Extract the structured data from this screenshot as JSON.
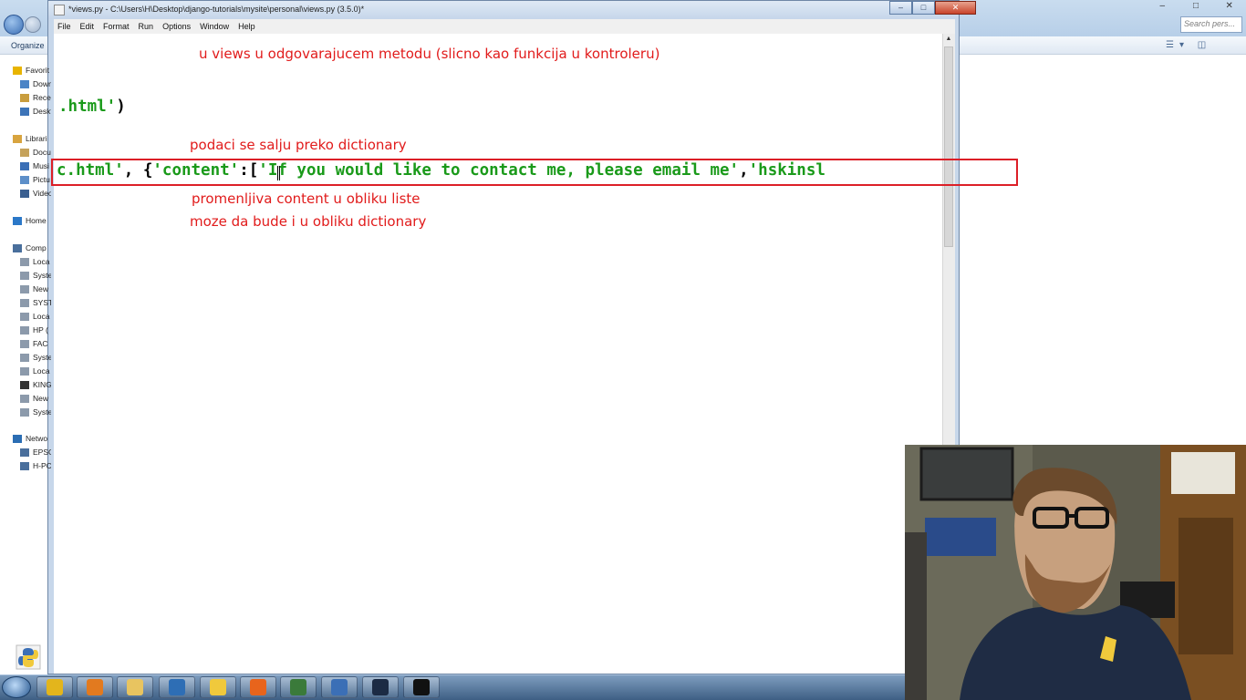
{
  "explorer": {
    "toolbar_label": "Organize",
    "search_placeholder": "Search pers...",
    "window_buttons": [
      "–",
      "□",
      "✕"
    ],
    "nav_items": [
      {
        "label": "Favorit",
        "child": false,
        "icon": "star-icon",
        "color": "#e8b400"
      },
      {
        "label": "Down",
        "child": true,
        "icon": "downloads-folder-icon",
        "color": "#4b84c6"
      },
      {
        "label": "Rece",
        "child": true,
        "icon": "recent-places-icon",
        "color": "#c99d3d"
      },
      {
        "label": "Deskt",
        "child": true,
        "icon": "desktop-icon",
        "color": "#3d74b8"
      },
      {
        "label": "Librari",
        "child": false,
        "icon": "libraries-icon",
        "color": "#d8a43f"
      },
      {
        "label": "Docu",
        "child": true,
        "icon": "documents-icon",
        "color": "#c5a25b"
      },
      {
        "label": "Musi",
        "child": true,
        "icon": "music-icon",
        "color": "#3b6fb6"
      },
      {
        "label": "Pictu",
        "child": true,
        "icon": "pictures-icon",
        "color": "#5d8fc9"
      },
      {
        "label": "Video",
        "child": true,
        "icon": "videos-icon",
        "color": "#3a5f90"
      },
      {
        "label": "Home",
        "child": false,
        "icon": "homegroup-icon",
        "color": "#2b78c8"
      },
      {
        "label": "Comp",
        "child": false,
        "icon": "computer-icon",
        "color": "#4a6f9c"
      },
      {
        "label": "Loca",
        "child": true,
        "icon": "drive-icon",
        "color": "#8c9aab"
      },
      {
        "label": "Syste",
        "child": true,
        "icon": "drive-icon",
        "color": "#8c9aab"
      },
      {
        "label": "New",
        "child": true,
        "icon": "drive-icon",
        "color": "#8c9aab"
      },
      {
        "label": "SYST",
        "child": true,
        "icon": "drive-icon",
        "color": "#8c9aab"
      },
      {
        "label": "Loca",
        "child": true,
        "icon": "drive-icon",
        "color": "#8c9aab"
      },
      {
        "label": "HP (",
        "child": true,
        "icon": "drive-icon",
        "color": "#8c9aab"
      },
      {
        "label": "FAC",
        "child": true,
        "icon": "drive-icon",
        "color": "#8c9aab"
      },
      {
        "label": "Syste",
        "child": true,
        "icon": "drive-icon",
        "color": "#8c9aab"
      },
      {
        "label": "Loca",
        "child": true,
        "icon": "drive-icon",
        "color": "#8c9aab"
      },
      {
        "label": "KING",
        "child": true,
        "icon": "usb-drive-icon",
        "color": "#333333"
      },
      {
        "label": "New",
        "child": true,
        "icon": "drive-icon",
        "color": "#8c9aab"
      },
      {
        "label": "Syste",
        "child": true,
        "icon": "drive-icon",
        "color": "#8c9aab"
      },
      {
        "label": "Netwo",
        "child": false,
        "icon": "network-icon",
        "color": "#2b6db3"
      },
      {
        "label": "EPSO",
        "child": true,
        "icon": "network-computer-icon",
        "color": "#4a6f9c"
      },
      {
        "label": "H-PC",
        "child": true,
        "icon": "network-computer-icon",
        "color": "#4a6f9c"
      }
    ]
  },
  "editor": {
    "title": "*views.py - C:\\Users\\H\\Desktop\\django-tutorials\\mysite\\personal\\views.py (3.5.0)*",
    "window_buttons": [
      "–",
      "□",
      "✕"
    ],
    "menu": [
      "File",
      "Edit",
      "Format",
      "Run",
      "Options",
      "Window",
      "Help"
    ],
    "code": {
      "line1_string": ".html'",
      "line1_paren": ")",
      "line2_string1": "c.html'",
      "line2_sep1": ", {",
      "line2_key": "'content'",
      "line2_sep2": ":[",
      "line2_item1": "'If you would like to contact me, please email me'",
      "line2_sep3": ",",
      "line2_item2": "'hskinsl"
    },
    "annotations": {
      "views_note": "u views u odgovarajucem metodu (slicno kao funkcija u kontroleru)",
      "dict_note": "podaci se salju preko dictionary",
      "list_note": "promenljiva content u obliku liste",
      "dict_alt_note": "moze da bude i u obliku dictionary"
    }
  },
  "taskbar": {
    "apps": [
      {
        "name": "chrome-icon",
        "color": "#e3b51c"
      },
      {
        "name": "media-player-icon",
        "color": "#e27a1f"
      },
      {
        "name": "file-explorer-icon",
        "color": "#e8c460"
      },
      {
        "name": "idle-editor-icon",
        "color": "#2e6eb5"
      },
      {
        "name": "python-icon",
        "color": "#f0c93c"
      },
      {
        "name": "firefox-icon",
        "color": "#e8641c"
      },
      {
        "name": "network-tool-icon",
        "color": "#3a7a3a"
      },
      {
        "name": "python-launcher-icon",
        "color": "#3b6fb6"
      },
      {
        "name": "remote-desktop-icon",
        "color": "#1c2b44"
      },
      {
        "name": "command-prompt-icon",
        "color": "#111111"
      }
    ]
  }
}
